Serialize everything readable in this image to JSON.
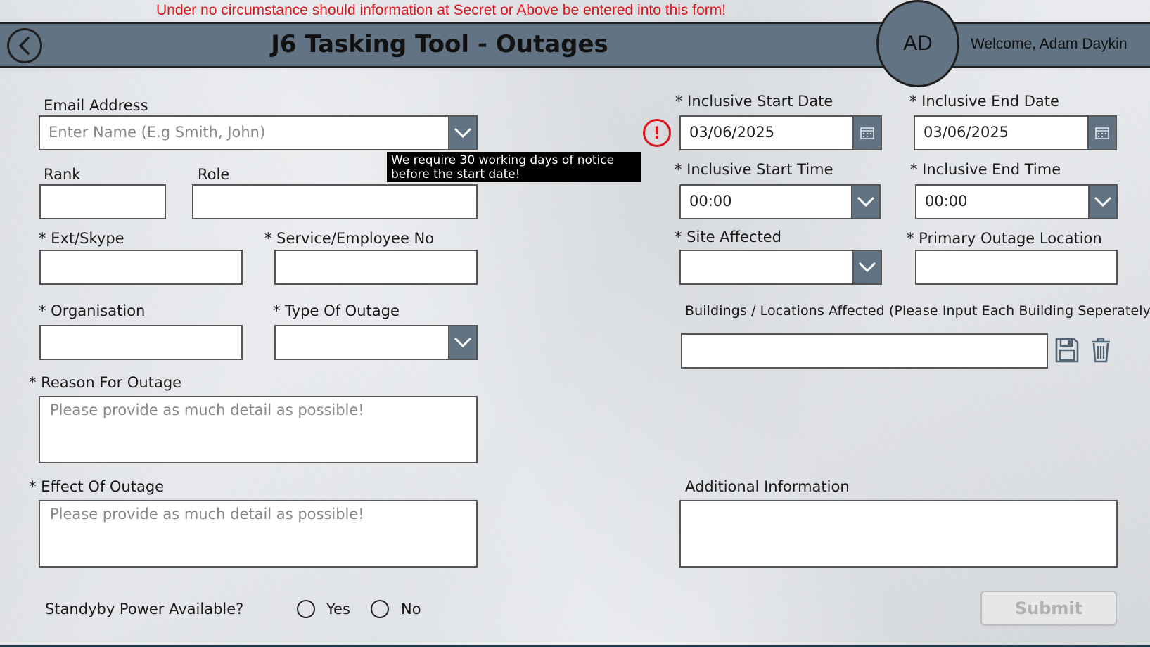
{
  "banner": {
    "warning": "Under no circumstance should information at Secret or Above be entered into this form!"
  },
  "header": {
    "title": "J6 Tasking Tool - Outages",
    "avatar_initials": "AD",
    "welcome": "Welcome, Adam Daykin"
  },
  "form": {
    "email": {
      "label": "Email Address",
      "placeholder": "Enter Name (E.g Smith, John)"
    },
    "rank": {
      "label": "Rank"
    },
    "role": {
      "label": "Role"
    },
    "ext": {
      "label": "* Ext/Skype"
    },
    "service_no": {
      "label": "* Service/Employee No"
    },
    "organisation": {
      "label": "* Organisation"
    },
    "type_of_outage": {
      "label": "* Type Of Outage"
    },
    "reason": {
      "label": "* Reason For Outage",
      "placeholder": "Please provide as much detail as possible!"
    },
    "effect": {
      "label": "* Effect Of Outage",
      "placeholder": "Please provide as much detail as possible!"
    },
    "standby": {
      "label": "Standyby Power Available?",
      "yes": "Yes",
      "no": "No"
    },
    "start_date": {
      "label": "* Inclusive Start Date",
      "value": "03/06/2025"
    },
    "end_date": {
      "label": "* Inclusive End Date",
      "value": "03/06/2025"
    },
    "start_time": {
      "label": "* Inclusive Start Time",
      "value": "00:00"
    },
    "end_time": {
      "label": "* Inclusive End Time",
      "value": "00:00"
    },
    "site_affected": {
      "label": "* Site Affected"
    },
    "primary_location": {
      "label": "* Primary Outage Location"
    },
    "buildings": {
      "label": "Buildings / Locations Affected (Please Input Each Building Seperately)"
    },
    "additional": {
      "label": "Additional Information"
    },
    "submit_label": "Submit"
  },
  "tooltip": {
    "text": "We require 30 working days of notice before the start date!"
  },
  "icons": {
    "back": "back-arrow-icon",
    "dropdown": "chevron-down-icon",
    "calendar": "calendar-icon",
    "error": "exclamation-icon",
    "save": "save-icon",
    "delete": "trash-icon"
  },
  "colors": {
    "header": "#627484",
    "warning": "#e0141a",
    "background": "#dfe2e6"
  }
}
